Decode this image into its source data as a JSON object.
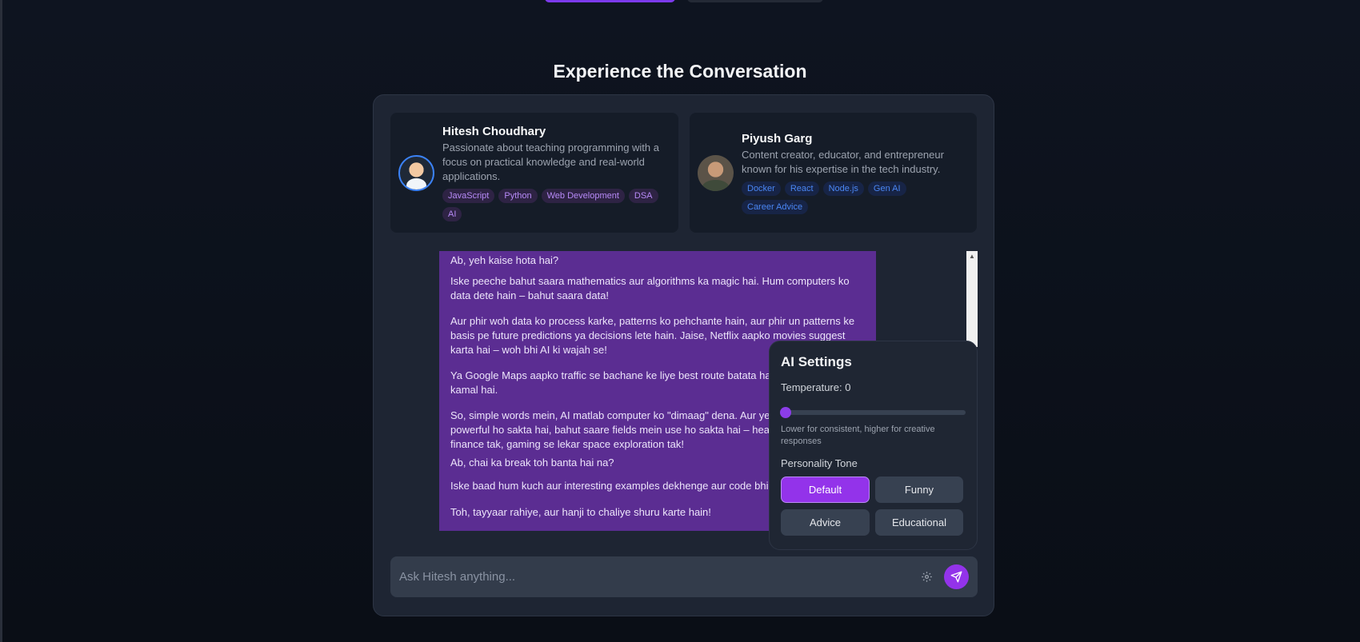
{
  "section": {
    "title": "Experience the Conversation"
  },
  "profiles": [
    {
      "name": "Hitesh Choudhary",
      "description": "Passionate about teaching programming with a focus on practical knowledge and real-world applications.",
      "tags": [
        "JavaScript",
        "Python",
        "Web Development",
        "DSA",
        "AI"
      ]
    },
    {
      "name": "Piyush Garg",
      "description": "Content creator, educator, and entrepreneur known for his expertise in the tech industry.",
      "tags": [
        "Docker",
        "React",
        "Node.js",
        "Gen AI",
        "Career Advice"
      ]
    }
  ],
  "message": {
    "paragraphs": [
      "Ab, yeh kaise hota hai?",
      "Iske peeche bahut saara mathematics aur algorithms ka magic hai.  Hum computers ko data dete hain –  bahut saara data!",
      "Aur phir woh data ko process karke, patterns ko pehchante hain, aur phir un patterns ke basis pe future predictions ya decisions lete hain.  Jaise, Netflix aapko movies suggest karta hai – woh bhi AI ki wajah se!",
      "Ya Google Maps aapko traffic se bachane ke liye best route batata hai – yeh bhi AI hi kamal hai.",
      "So, simple words mein, AI matlab computer ko \"dimaag\" dena.  Aur yeh dimaag bahut powerful ho sakta hai,  bahut saare fields mein use ho sakta hai – healthcare se lekar finance tak, gaming se lekar space exploration tak!",
      "Ab,  chai ka break toh banta hai na?",
      "Iske baad hum kuch aur interesting examples dekhenge aur code bhi likhenge.",
      "Toh,  tayyaar rahiye,  aur  hanji to chaliye shuru karte hain!"
    ]
  },
  "settings": {
    "title": "AI Settings",
    "temperature_label": "Temperature: 0",
    "temperature_value": 0,
    "hint": "Lower for consistent, higher for creative responses",
    "tone_label": "Personality Tone",
    "tones": [
      "Default",
      "Funny",
      "Advice",
      "Educational"
    ],
    "selected_tone": "Default"
  },
  "composer": {
    "placeholder": "Ask Hitesh anything..."
  },
  "icons": {
    "settings": "gear-icon",
    "send": "send-icon"
  },
  "colors": {
    "accent": "#9333ea",
    "bubble": "#5b2d92"
  }
}
